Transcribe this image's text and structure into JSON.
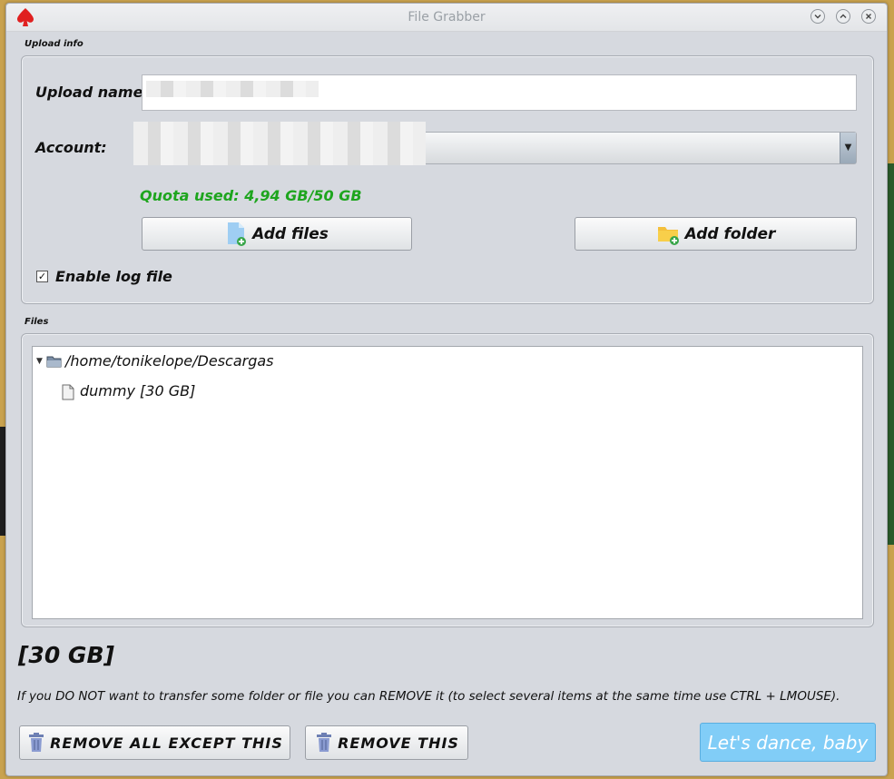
{
  "window": {
    "title": "File Grabber"
  },
  "upload_info": {
    "section_label": "Upload info",
    "upload_name_label": "Upload name:",
    "upload_name_value": "",
    "account_label": "Account:",
    "account_value": "",
    "quota_text": "Quota used: 4,94 GB/50 GB",
    "add_files_label": "Add files",
    "add_folder_label": "Add folder",
    "enable_log_label": "Enable log file",
    "enable_log_checked": true
  },
  "files": {
    "section_label": "Files",
    "tree": [
      {
        "label": "/home/tonikelope/Descargas",
        "type": "folder",
        "expanded": true
      },
      {
        "label": "dummy [30 GB]",
        "type": "file"
      }
    ]
  },
  "total_size": "[30 GB]",
  "help_text": "If you DO NOT want to transfer some folder or file you can REMOVE it (to select several items at the same time use CTRL + LMOUSE).",
  "actions": {
    "remove_all_except_label": "REMOVE ALL EXCEPT THIS",
    "remove_this_label": "REMOVE THIS",
    "go_label": "Let's dance, baby"
  },
  "colors": {
    "quota": "#1ea51e",
    "go_button": "#81cdf7",
    "app_icon": "#e02020"
  },
  "icons": [
    "spade-icon",
    "minimize-icon",
    "maximize-icon",
    "close-icon",
    "add-file-icon",
    "add-folder-icon",
    "folder-icon",
    "file-icon",
    "trash-icon"
  ]
}
